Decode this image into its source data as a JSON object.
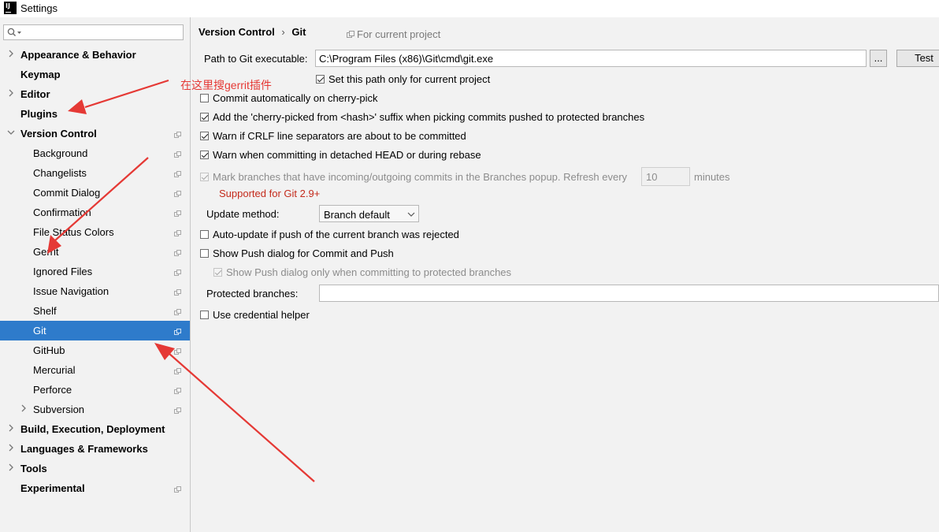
{
  "window": {
    "title": "Settings",
    "logo": "IJ"
  },
  "search": {
    "placeholder": "",
    "icon": "search-icon"
  },
  "sidebar": {
    "items": [
      {
        "label": "Appearance & Behavior",
        "bold": true,
        "expander": "collapsed",
        "indent": 0,
        "project_icon": false
      },
      {
        "label": "Keymap",
        "bold": true,
        "expander": "none",
        "indent": 0,
        "project_icon": false
      },
      {
        "label": "Editor",
        "bold": true,
        "expander": "collapsed",
        "indent": 0,
        "project_icon": false
      },
      {
        "label": "Plugins",
        "bold": true,
        "expander": "none",
        "indent": 0,
        "project_icon": false
      },
      {
        "label": "Version Control",
        "bold": true,
        "expander": "expanded",
        "indent": 0,
        "project_icon": true
      },
      {
        "label": "Background",
        "bold": false,
        "expander": "none",
        "indent": 1,
        "project_icon": true
      },
      {
        "label": "Changelists",
        "bold": false,
        "expander": "none",
        "indent": 1,
        "project_icon": true
      },
      {
        "label": "Commit Dialog",
        "bold": false,
        "expander": "none",
        "indent": 1,
        "project_icon": true
      },
      {
        "label": "Confirmation",
        "bold": false,
        "expander": "none",
        "indent": 1,
        "project_icon": true
      },
      {
        "label": "File Status Colors",
        "bold": false,
        "expander": "none",
        "indent": 1,
        "project_icon": true
      },
      {
        "label": "Gerrit",
        "bold": false,
        "expander": "none",
        "indent": 1,
        "project_icon": true
      },
      {
        "label": "Ignored Files",
        "bold": false,
        "expander": "none",
        "indent": 1,
        "project_icon": true
      },
      {
        "label": "Issue Navigation",
        "bold": false,
        "expander": "none",
        "indent": 1,
        "project_icon": true
      },
      {
        "label": "Shelf",
        "bold": false,
        "expander": "none",
        "indent": 1,
        "project_icon": true
      },
      {
        "label": "Git",
        "bold": false,
        "expander": "none",
        "indent": 1,
        "project_icon": true,
        "selected": true
      },
      {
        "label": "GitHub",
        "bold": false,
        "expander": "none",
        "indent": 1,
        "project_icon": true
      },
      {
        "label": "Mercurial",
        "bold": false,
        "expander": "none",
        "indent": 1,
        "project_icon": true
      },
      {
        "label": "Perforce",
        "bold": false,
        "expander": "none",
        "indent": 1,
        "project_icon": true
      },
      {
        "label": "Subversion",
        "bold": false,
        "expander": "collapsed",
        "indent": 1,
        "project_icon": true
      },
      {
        "label": "Build, Execution, Deployment",
        "bold": true,
        "expander": "collapsed",
        "indent": 0,
        "project_icon": false
      },
      {
        "label": "Languages & Frameworks",
        "bold": true,
        "expander": "collapsed",
        "indent": 0,
        "project_icon": false
      },
      {
        "label": "Tools",
        "bold": true,
        "expander": "collapsed",
        "indent": 0,
        "project_icon": false
      },
      {
        "label": "Experimental",
        "bold": true,
        "expander": "none",
        "indent": 0,
        "project_icon": true
      }
    ]
  },
  "breadcrumb": {
    "parent": "Version Control",
    "separator": "›",
    "current": "Git",
    "scope": "For current project"
  },
  "git": {
    "path_label": "Path to Git executable:",
    "path_value": "C:\\Program Files (x86)\\Git\\cmd\\git.exe",
    "browse_label": "...",
    "test_label": "Test",
    "options": {
      "set_path_only": {
        "label": "Set this path only for current project",
        "checked": true
      },
      "commit_cherry": {
        "label": "Commit automatically on cherry-pick",
        "checked": false
      },
      "add_suffix": {
        "label": "Add the 'cherry-picked from <hash>' suffix when picking commits pushed to protected branches",
        "checked": true
      },
      "warn_crlf": {
        "label": "Warn if CRLF line separators are about to be committed",
        "checked": true
      },
      "warn_detached": {
        "label": "Warn when committing in detached HEAD or during rebase",
        "checked": true
      },
      "mark_branches": {
        "label": "Mark branches that have incoming/outgoing commits in the Branches popup.  Refresh every",
        "checked": true,
        "disabled": true
      },
      "auto_update": {
        "label": "Auto-update if push of the current branch was rejected",
        "checked": false
      },
      "show_push": {
        "label": "Show Push dialog for Commit and Push",
        "checked": false
      },
      "show_push_protected": {
        "label": "Show Push dialog only when committing to protected branches",
        "checked": true,
        "disabled": true
      },
      "credential_helper": {
        "label": "Use credential helper",
        "checked": false
      }
    },
    "refresh_value": "10",
    "minutes_label": "minutes",
    "supported_note": "Supported for Git 2.9+",
    "update_method_label": "Update method:",
    "update_method_value": "Branch default",
    "protected_label": "Protected branches:",
    "protected_value": ""
  },
  "annotation": {
    "text": "在这里搜gerrit插件",
    "color": "#e53935"
  },
  "colors": {
    "selection": "#2e7bcb",
    "accent_red": "#c42b1c",
    "annotation_red": "#e53935"
  }
}
